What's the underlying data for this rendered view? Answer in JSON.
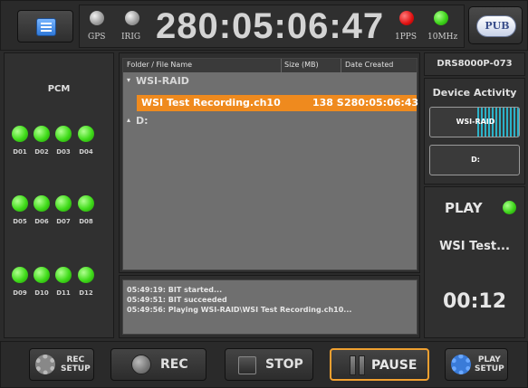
{
  "top": {
    "gps_label": "GPS",
    "irig_label": "IRIG",
    "clock": "280:05:06:47",
    "pps_label": "1PPS",
    "mhz_label": "10MHz",
    "pub_label": "PUB",
    "status_colors": {
      "gps": "#9a9a9a",
      "irig": "#9a9a9a",
      "pps": "#e01010",
      "mhz": "#3ed41a"
    }
  },
  "pcm": {
    "title": "PCM",
    "rows": [
      [
        "D01",
        "D02",
        "D03",
        "D04"
      ],
      [
        "D05",
        "D06",
        "D07",
        "D08"
      ],
      [
        "D09",
        "D10",
        "D11",
        "D12"
      ]
    ]
  },
  "browser": {
    "col_name": "Folder / File Name",
    "col_size": "Size (MB)",
    "col_date": "Date Created",
    "folder1": "WSI-RAID",
    "file_name": "WSI Test Recording.ch10",
    "file_size": "138 S",
    "file_date": "280:05:06:43",
    "folder2": "D:",
    "selected_color": "#ef8a1e"
  },
  "log": {
    "lines": [
      "05:49:19: BIT started...",
      "05:49:51: BIT succeeded",
      "05:49:56: Playing WSI-RAID\\WSI Test Recording.ch10..."
    ]
  },
  "right": {
    "device_name": "DRS8000P-073",
    "activity_title": "Device Activity",
    "drive1": "WSI-RAID",
    "drive2": "D:",
    "play_label": "PLAY",
    "play_name": "WSI Test...",
    "play_time": "00:12"
  },
  "bottom": {
    "rec_setup": "REC\nSETUP",
    "rec": "REC",
    "stop": "STOP",
    "pause": "PAUSE",
    "play_setup": "PLAY\nSETUP",
    "pause_border": "#f0a030"
  }
}
